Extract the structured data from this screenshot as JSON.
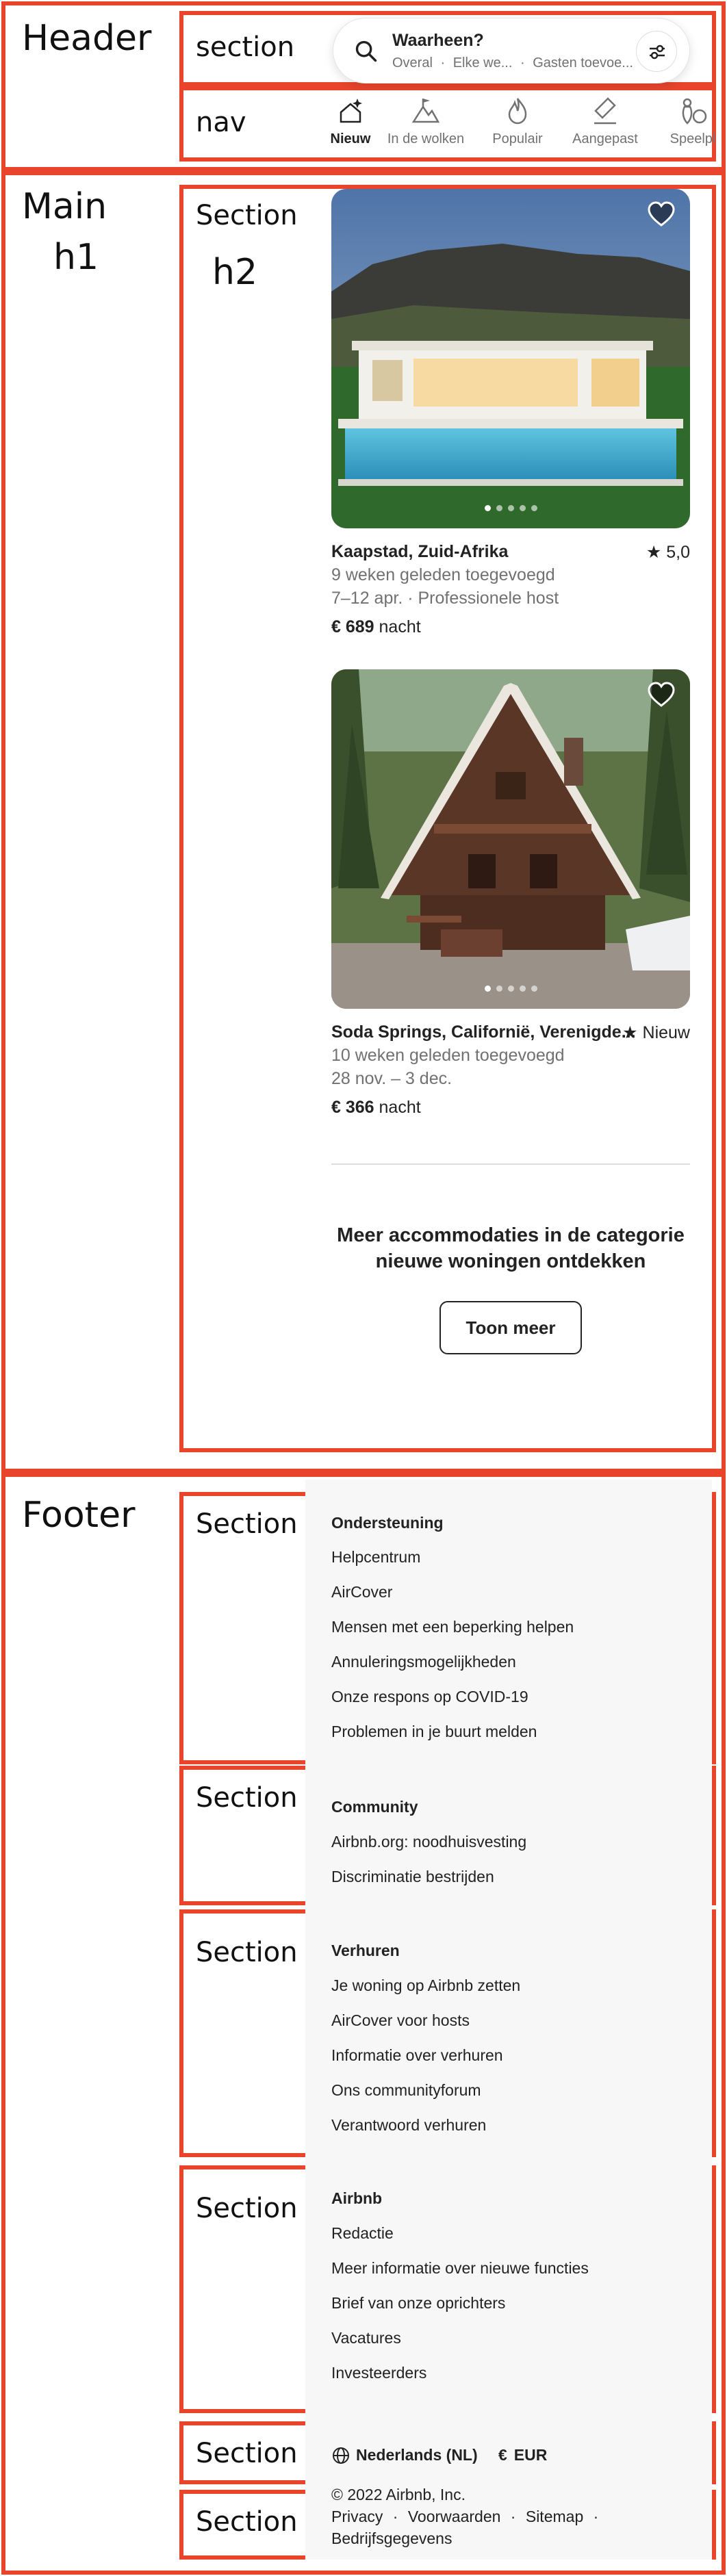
{
  "annotations": {
    "header": "Header",
    "header_section": "section",
    "header_nav": "nav",
    "main": "Main",
    "main_h1": "h1",
    "main_section": "Section",
    "main_h2": "h2",
    "footer": "Footer",
    "footer_section": "Section"
  },
  "search": {
    "title": "Waarheen?",
    "where": "Overal",
    "when": "Elke we...",
    "guests": "Gasten toevoe..."
  },
  "categories": [
    {
      "label": "Nieuw",
      "icon": "sparkle-house-icon",
      "active": true
    },
    {
      "label": "In de wolken",
      "icon": "mountain-flag-icon",
      "active": false
    },
    {
      "label": "Populair",
      "icon": "flame-icon",
      "active": false
    },
    {
      "label": "Aangepast",
      "icon": "pen-icon",
      "active": false
    },
    {
      "label": "Speelpl",
      "icon": "bowling-icon",
      "active": false
    }
  ],
  "listings": [
    {
      "location": "Kaapstad, Zuid-Afrika",
      "rating": "5,0",
      "added": "9 weken geleden toegevoegd",
      "dates_host": "7–12 apr. · Professionele host",
      "price": "€ 689",
      "price_unit": "nacht"
    },
    {
      "location": "Soda Springs, Californië, Verenigde...",
      "rating": "Nieuw",
      "added": "10 weken geleden toegevoegd",
      "dates_host": "28 nov. – 3 dec.",
      "price": "€ 366",
      "price_unit": "nacht"
    }
  ],
  "more": {
    "text": "Meer accommodaties in de categorie nieuwe woningen ontdekken",
    "button": "Toon meer"
  },
  "footer": {
    "support": {
      "heading": "Ondersteuning",
      "links": [
        "Helpcentrum",
        "AirCover",
        "Mensen met een beperking helpen",
        "Annuleringsmogelijkheden",
        "Onze respons op COVID-19",
        "Problemen in je buurt melden"
      ]
    },
    "community": {
      "heading": "Community",
      "links": [
        "Airbnb.org: noodhuisvesting",
        "Discriminatie bestrijden"
      ]
    },
    "hosting": {
      "heading": "Verhuren",
      "links": [
        "Je woning op Airbnb zetten",
        "AirCover voor hosts",
        "Informatie over verhuren",
        "Ons communityforum",
        "Verantwoord verhuren"
      ]
    },
    "airbnb": {
      "heading": "Airbnb",
      "links": [
        "Redactie",
        "Meer informatie over nieuwe functies",
        "Brief van onze oprichters",
        "Vacatures",
        "Investeerders"
      ]
    },
    "language": "Nederlands (NL)",
    "currency_symbol": "€",
    "currency": "EUR",
    "copyright": "© 2022 Airbnb, Inc.",
    "legal": [
      "Privacy",
      "Voorwaarden",
      "Sitemap",
      "Bedrijfsgegevens"
    ]
  },
  "colors": {
    "annotation_border": "#e8452c",
    "text": "#222222",
    "muted": "#717171",
    "footer_bg": "#f7f7f7"
  }
}
